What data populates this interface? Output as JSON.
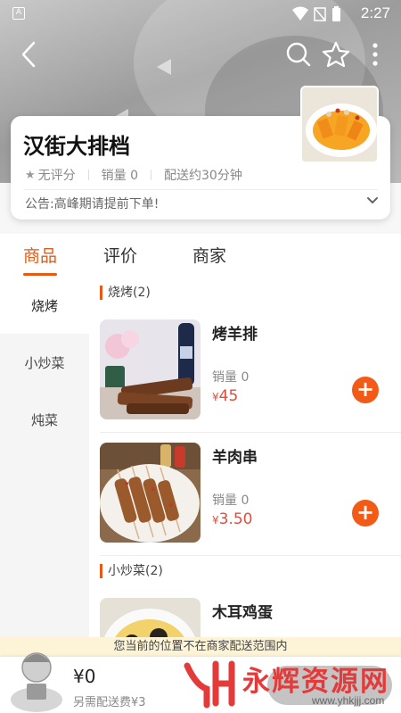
{
  "status_bar": {
    "left_badge": "A",
    "time": "2:27"
  },
  "shop": {
    "name": "汉街大排档",
    "rating": "无评分",
    "sales": "销量 0",
    "delivery": "配送约30分钟",
    "notice": "公告:高峰期请提前下单!"
  },
  "tabs": [
    {
      "label": "商品",
      "active": true
    },
    {
      "label": "评价",
      "active": false
    },
    {
      "label": "商家",
      "active": false
    }
  ],
  "categories": [
    {
      "label": "烧烤",
      "active": true
    },
    {
      "label": "小炒菜",
      "active": false
    },
    {
      "label": "炖菜",
      "active": false
    }
  ],
  "sections": [
    {
      "title": "烧烤(2)",
      "products": [
        {
          "name": "烤羊排",
          "sales": "销量 0",
          "currency": "¥",
          "price": "45"
        },
        {
          "name": "羊肉串",
          "sales": "销量 0",
          "currency": "¥",
          "price": "3.50"
        }
      ]
    },
    {
      "title": "小炒菜(2)",
      "products": [
        {
          "name": "木耳鸡蛋"
        }
      ]
    }
  ],
  "range_notice": "您当前的位置不在商家配送范围内",
  "cart": {
    "total": "¥0",
    "fee_note": "另需配送费¥3"
  },
  "watermark": {
    "text": "永辉资源网",
    "url": "www.yhkjjj.com"
  },
  "colors": {
    "accent": "#e35b16",
    "price": "#e64b3b",
    "add_button": "#f25a17"
  }
}
